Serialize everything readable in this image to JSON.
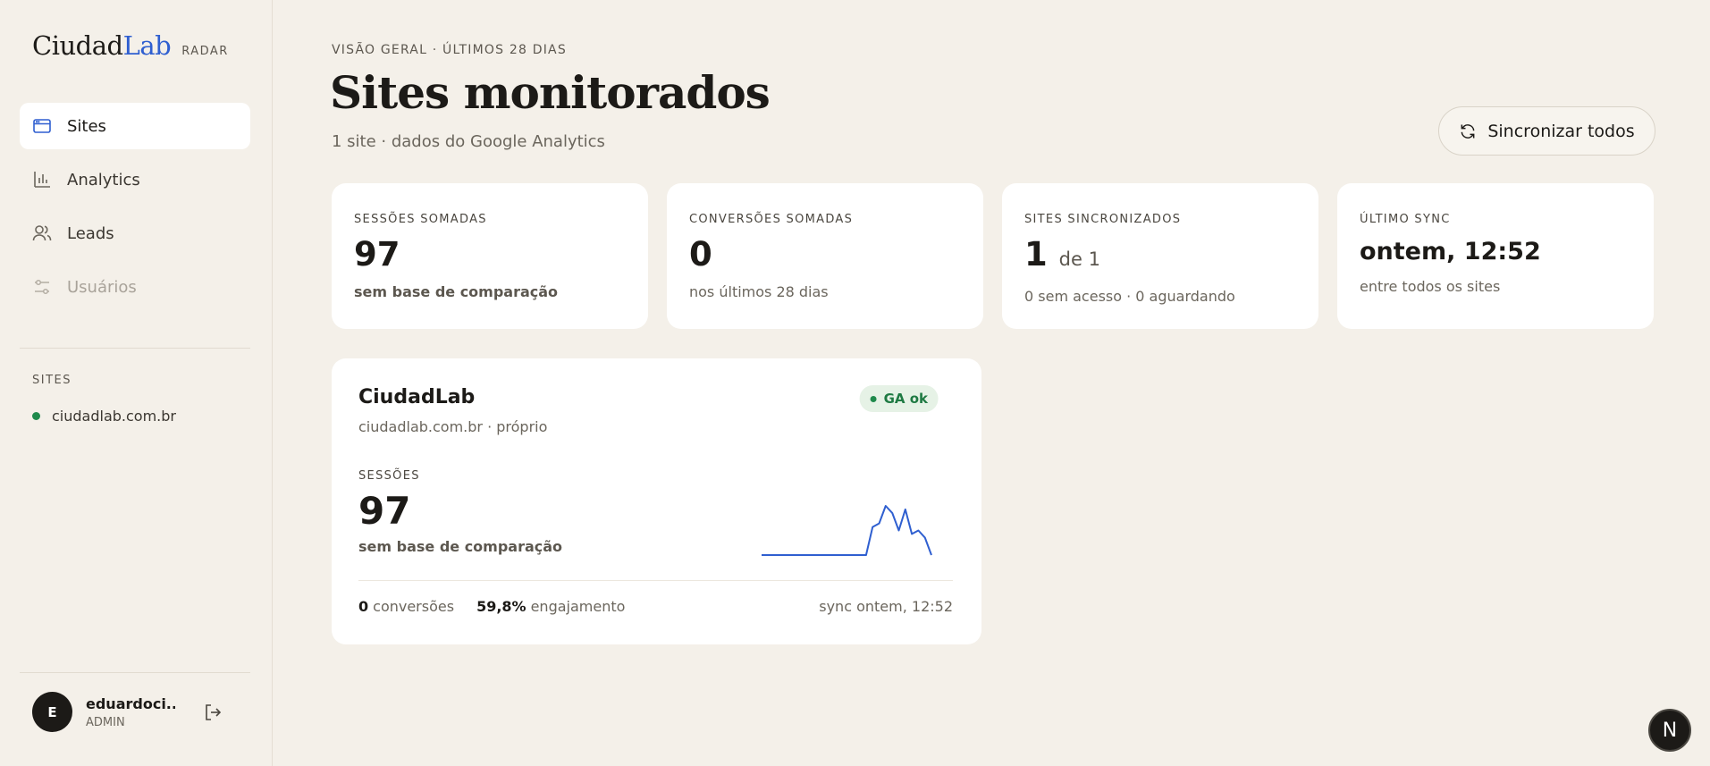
{
  "brand": {
    "name_part1": "Ciudad",
    "name_part2": "Lab",
    "tag": "RADAR",
    "accent": "#2f5fd0"
  },
  "nav": {
    "items": [
      {
        "label": "Sites",
        "icon": "browser-window-icon",
        "state": "active"
      },
      {
        "label": "Analytics",
        "icon": "bar-chart-icon",
        "state": "normal"
      },
      {
        "label": "Leads",
        "icon": "users-icon",
        "state": "normal"
      },
      {
        "label": "Usuários",
        "icon": "sliders-icon",
        "state": "disabled"
      }
    ]
  },
  "sidebar_sites": {
    "heading": "SITES",
    "items": [
      {
        "label": "ciudadlab.com.br",
        "status_color": "#1f8a4c"
      }
    ]
  },
  "user": {
    "initial": "E",
    "name": "eduardoci...",
    "role": "ADMIN"
  },
  "header": {
    "eyebrow": "VISÃO GERAL · ÚLTIMOS 28 DIAS",
    "title": "Sites monitorados",
    "subtitle": "1 site · dados do Google Analytics",
    "sync_button": "Sincronizar todos"
  },
  "stats": [
    {
      "label": "SESSÕES SOMADAS",
      "value": "97",
      "note": "sem base de comparação"
    },
    {
      "label": "CONVERSÕES SOMADAS",
      "value": "0",
      "note": "nos últimos 28 dias"
    },
    {
      "label": "SITES SINCRONIZADOS",
      "value": "1",
      "value_suffix": "de 1",
      "note": "0 sem acesso · 0 aguardando"
    },
    {
      "label": "ÚLTIMO SYNC",
      "value": "ontem, 12:52",
      "note": "entre todos os sites"
    }
  ],
  "site_card": {
    "name": "CiudadLab",
    "subtitle": "ciudadlab.com.br · próprio",
    "badge": "GA ok",
    "metric_label": "SESSÕES",
    "metric_value": "97",
    "metric_note": "sem base de comparação",
    "sparkline": [
      0,
      0,
      0,
      0,
      0,
      0,
      0,
      0,
      0,
      0,
      0,
      0,
      0,
      0,
      0,
      0,
      0,
      8,
      9,
      14,
      12,
      7,
      13,
      6,
      7,
      5,
      0
    ],
    "sparkline_color": "#2f5fd0",
    "conversions_value": "0",
    "conversions_label": "conversões",
    "engagement_value": "59,8%",
    "engagement_label": "engajamento",
    "sync_text": "sync ontem, 12:52"
  },
  "floating_button": {
    "label": "N"
  }
}
